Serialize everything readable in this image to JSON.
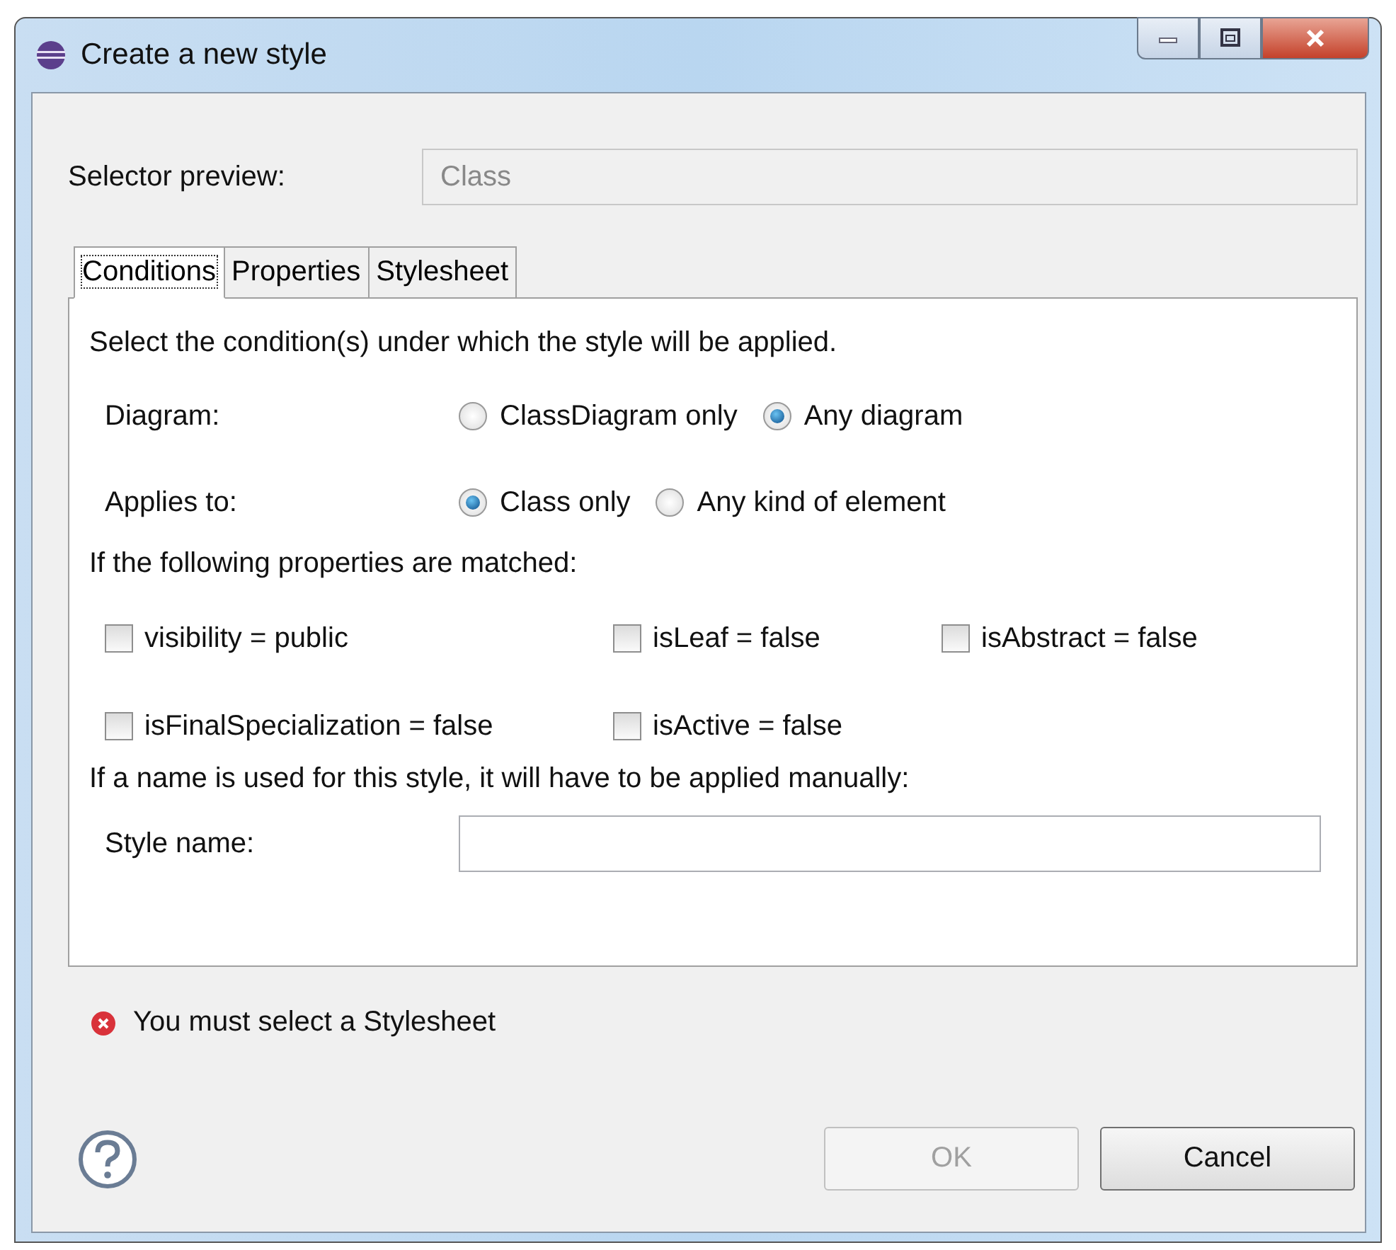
{
  "window": {
    "title": "Create a new style"
  },
  "selector_preview": {
    "label": "Selector preview:",
    "value": "Class",
    "disabled": true
  },
  "tabs": [
    {
      "label": "Conditions",
      "selected": true
    },
    {
      "label": "Properties",
      "selected": false
    },
    {
      "label": "Stylesheet",
      "selected": false
    }
  ],
  "conditions": {
    "intro": "Select the condition(s) under which the style will be applied.",
    "radio_groups": [
      {
        "label": "Diagram:",
        "options": [
          {
            "label": "ClassDiagram only",
            "selected": false
          },
          {
            "label": "Any diagram",
            "selected": true
          }
        ]
      },
      {
        "label": "Applies to:",
        "options": [
          {
            "label": "Class only",
            "selected": true
          },
          {
            "label": "Any kind of element",
            "selected": false
          }
        ]
      }
    ],
    "properties_heading": "If the following properties are matched:",
    "property_rows": [
      [
        {
          "label": "visibility = public",
          "checked": false
        },
        {
          "label": "isLeaf = false",
          "checked": false
        },
        {
          "label": "isAbstract = false",
          "checked": false
        }
      ],
      [
        {
          "label": "isFinalSpecialization = false",
          "checked": false
        },
        {
          "label": "isActive = false",
          "checked": false
        }
      ]
    ],
    "name_note": "If a name is used for this style, it will have to be applied manually:",
    "style_name": {
      "label": "Style name:"
    }
  },
  "error_message": "You must select a Stylesheet",
  "buttons": [
    {
      "label": "OK",
      "disabled": true
    },
    {
      "label": "Cancel",
      "disabled": false
    }
  ]
}
